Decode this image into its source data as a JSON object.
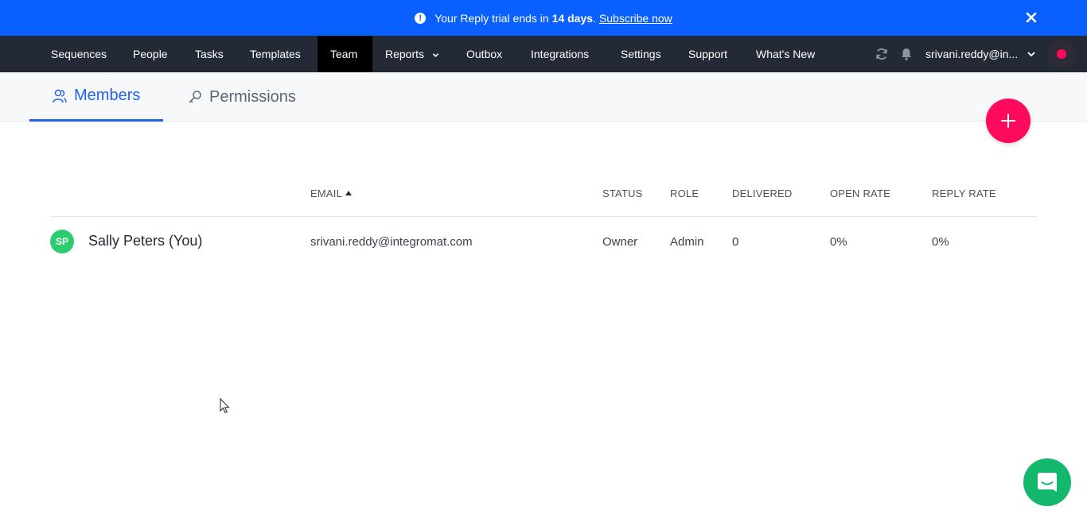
{
  "banner": {
    "text_before": "Your Reply trial ends in",
    "highlight": "14 days",
    "period": ".",
    "link": "Subscribe now",
    "alert_icon": "!"
  },
  "nav": {
    "items": [
      {
        "label": "Sequences"
      },
      {
        "label": "People"
      },
      {
        "label": "Tasks"
      },
      {
        "label": "Templates"
      },
      {
        "label": "Team"
      },
      {
        "label": "Reports"
      },
      {
        "label": "Outbox"
      },
      {
        "label": "Integrations"
      },
      {
        "label": "Settings"
      },
      {
        "label": "Support"
      },
      {
        "label": "What's New"
      }
    ],
    "active": "Team",
    "user": "srivani.reddy@in..."
  },
  "tabs": {
    "members": "Members",
    "permissions": "Permissions"
  },
  "table": {
    "headers": {
      "email": "EMAIL",
      "status": "STATUS",
      "role": "ROLE",
      "delivered": "DELIVERED",
      "open_rate": "OPEN RATE",
      "reply_rate": "REPLY RATE"
    },
    "rows": [
      {
        "initials": "SP",
        "name": "Sally Peters (You)",
        "email": "srivani.reddy@integromat.com",
        "status": "Owner",
        "role": "Admin",
        "delivered": "0",
        "open_rate": "0%",
        "reply_rate": "0%"
      }
    ]
  },
  "colors": {
    "banner": "#0a5fff",
    "nav": "#232935",
    "accent": "#1e63e9",
    "fab": "#ff0a5c",
    "avatar": "#2ecc71",
    "chat": "#14b86c"
  },
  "icons": {
    "banner": "alert-icon",
    "close": "close-icon",
    "refresh": "refresh-icon",
    "notifications": "bell-icon",
    "members_tab": "users-icon",
    "permissions_tab": "key-icon",
    "add": "plus-icon",
    "chat": "chat-icon"
  }
}
